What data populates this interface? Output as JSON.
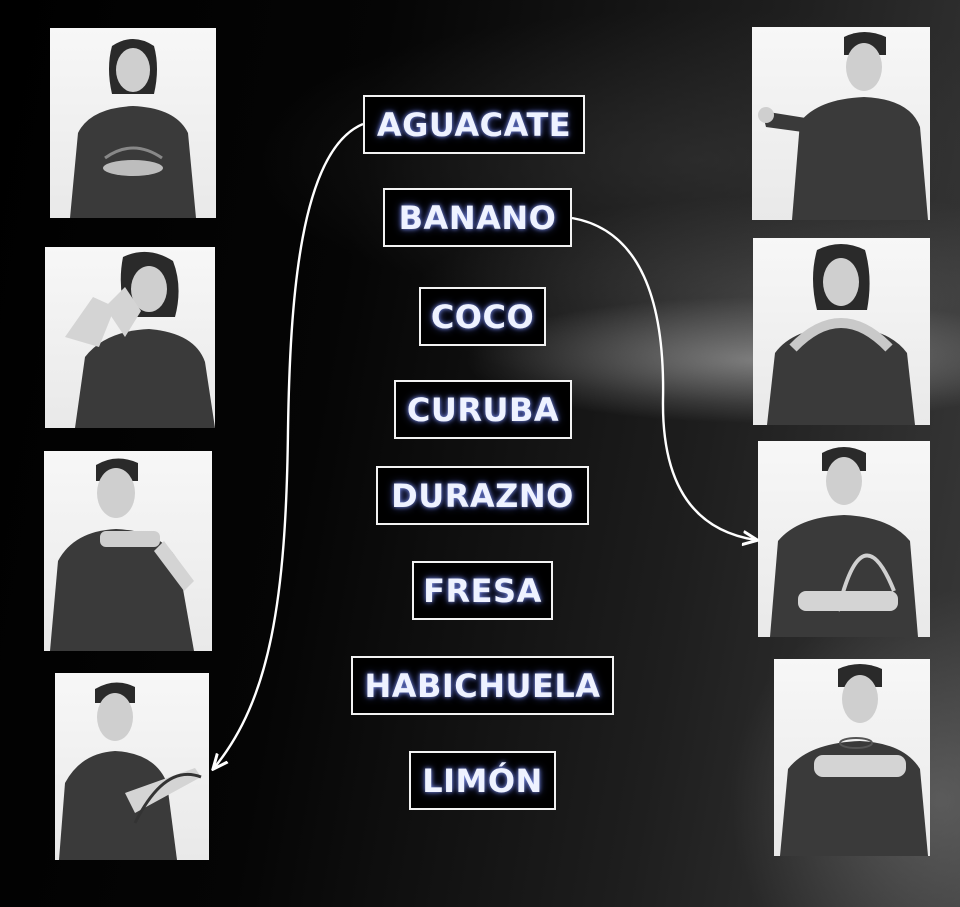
{
  "words": [
    {
      "id": "aguacate",
      "label": "AGUACATE"
    },
    {
      "id": "banano",
      "label": "BANANO"
    },
    {
      "id": "coco",
      "label": "COCO"
    },
    {
      "id": "curuba",
      "label": "CURUBA"
    },
    {
      "id": "durazno",
      "label": "DURAZNO"
    },
    {
      "id": "fresa",
      "label": "FRESA"
    },
    {
      "id": "habichuela",
      "label": "HABICHUELA"
    },
    {
      "id": "limon",
      "label": "LIMÓN"
    }
  ],
  "photos": {
    "left": [
      "woman-sign-photo",
      "woman-sign-photo",
      "man-sign-photo",
      "man-sign-photo"
    ],
    "right": [
      "man-sign-photo",
      "woman-sign-photo",
      "woman-sign-photo",
      "man-sign-photo"
    ]
  },
  "colors": {
    "background": "#000000",
    "box_border": "#f2f2f2",
    "text_glow": "#8ca0ff",
    "arrow": "#ffffff",
    "shirt": "#3a3a3a"
  }
}
